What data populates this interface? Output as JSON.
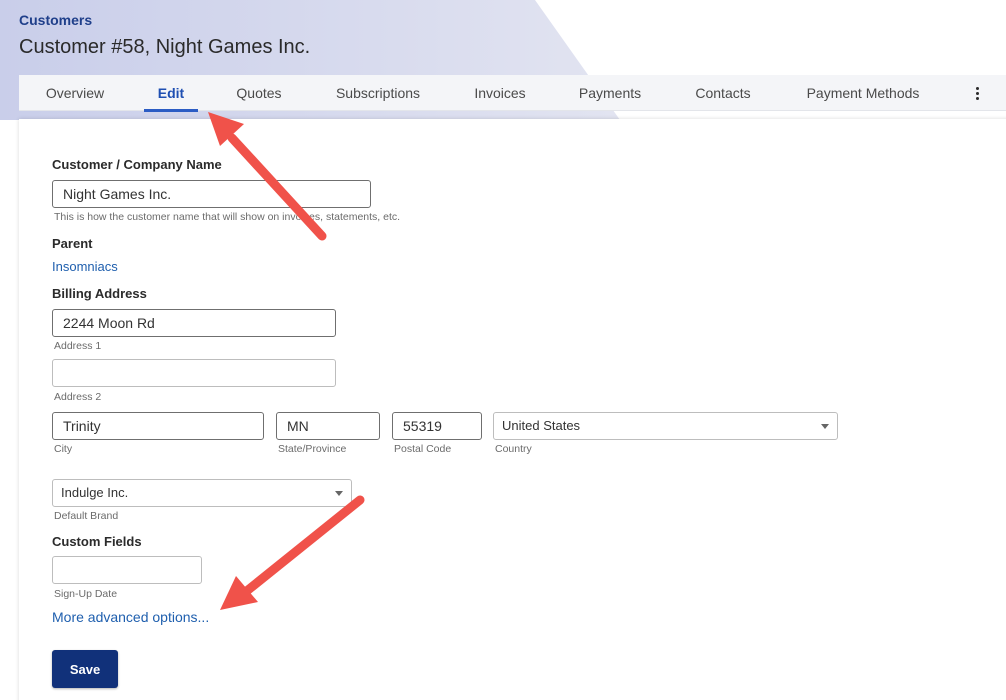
{
  "breadcrumb": "Customers",
  "title": "Customer #58, Night Games Inc.",
  "tabs": [
    {
      "label": "Overview"
    },
    {
      "label": "Edit"
    },
    {
      "label": "Quotes"
    },
    {
      "label": "Subscriptions"
    },
    {
      "label": "Invoices"
    },
    {
      "label": "Payments"
    },
    {
      "label": "Contacts"
    },
    {
      "label": "Payment Methods"
    }
  ],
  "active_tab": "Edit",
  "form": {
    "name_label": "Customer / Company Name",
    "name_value": "Night Games Inc.",
    "name_hint": "This is how the customer name that will show on invoices, statements, etc.",
    "parent_label": "Parent",
    "parent_value": "Insomniacs",
    "billing_label": "Billing Address",
    "address1_value": "2244 Moon Rd",
    "address1_hint": "Address 1",
    "address2_value": "",
    "address2_hint": "Address 2",
    "city_value": "Trinity",
    "city_hint": "City",
    "state_value": "MN",
    "state_hint": "State/Province",
    "postal_value": "55319",
    "postal_hint": "Postal Code",
    "country_value": "United States",
    "country_hint": "Country",
    "brand_value": "Indulge Inc.",
    "brand_hint": "Default Brand",
    "custom_label": "Custom Fields",
    "signup_value": "",
    "signup_hint": "Sign-Up Date",
    "advanced_link": "More advanced options...",
    "save_label": "Save"
  },
  "colors": {
    "accent": "#1f4fb2",
    "button": "#11317a",
    "annotation_arrow": "#f0524a"
  }
}
